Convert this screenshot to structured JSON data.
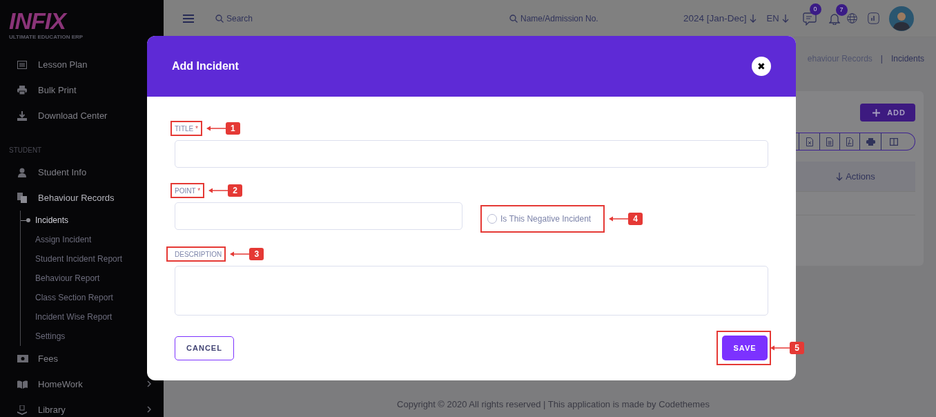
{
  "sidebar": {
    "logo": {
      "wordmark": "INFIX",
      "tagline": "ULTIMATE EDUCATION ERP"
    },
    "items": [
      {
        "kind": "link",
        "label": "Lesson Plan",
        "selected": false
      },
      {
        "kind": "link",
        "label": "Bulk Print",
        "selected": false
      },
      {
        "kind": "link",
        "label": "Download Center",
        "selected": false
      },
      {
        "kind": "heading",
        "label": "STUDENT"
      },
      {
        "kind": "link",
        "label": "Student Info",
        "selected": false
      },
      {
        "kind": "link",
        "label": "Behaviour Records",
        "selected": true,
        "expanded": true,
        "children": [
          {
            "label": "Incidents",
            "selected": true
          },
          {
            "label": "Assign Incident",
            "selected": false
          },
          {
            "label": "Student Incident Report",
            "selected": false
          },
          {
            "label": "Behaviour Report",
            "selected": false
          },
          {
            "label": "Class Section Report",
            "selected": false
          },
          {
            "label": "Incident Wise Report",
            "selected": false
          },
          {
            "label": "Settings",
            "selected": false
          }
        ]
      },
      {
        "kind": "link",
        "label": "Fees",
        "selected": false
      },
      {
        "kind": "link",
        "label": "HomeWork",
        "selected": false,
        "expanded": false
      },
      {
        "kind": "link",
        "label": "Library",
        "selected": false,
        "expanded": false
      }
    ]
  },
  "topbar": {
    "search": {
      "placeholder": "Search"
    },
    "admission_search": {
      "placeholder": "Name/Admission No."
    },
    "session": "2024 [Jan-Dec]",
    "language": "EN",
    "message_count": "0",
    "notification_count": "7"
  },
  "breadcrumb": {
    "items": [
      {
        "label": "ehaviour Records",
        "selected": false
      },
      {
        "label": "Incidents",
        "selected": true
      }
    ],
    "separator": "|"
  },
  "card": {
    "add_button": "ADD",
    "table": {
      "columns": [
        "Actions"
      ]
    }
  },
  "footer": "Copyright © 2020 All rights reserved | This application is made by Codethemes",
  "modal": {
    "title": "Add Incident",
    "close": "✖",
    "fields": [
      {
        "kind": "text",
        "label": "TITLE",
        "required_mark": "*",
        "callout": "1"
      },
      {
        "kind": "number",
        "label": "POINT",
        "required_mark": "*",
        "callout": "2"
      },
      {
        "kind": "textarea",
        "label": "DESCRIPTION",
        "callout": "3"
      }
    ],
    "negative_option": {
      "label": "Is This Negative Incident",
      "checked": false,
      "callout": "4"
    },
    "buttons": [
      {
        "kind": "secondary",
        "label": "CANCEL"
      },
      {
        "kind": "primary",
        "label": "SAVE",
        "callout": "5"
      }
    ]
  }
}
